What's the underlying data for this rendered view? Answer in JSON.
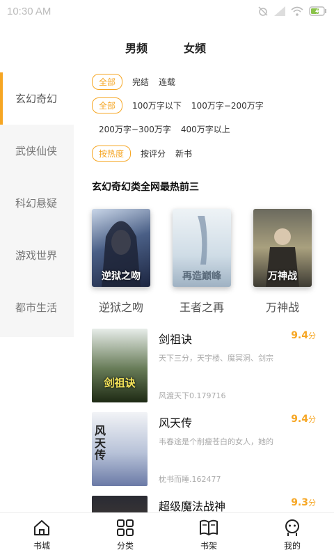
{
  "status": {
    "time": "10:30 AM",
    "icons": [
      "alarm-off-icon",
      "signal-icon",
      "wifi-icon",
      "battery-charging-icon"
    ]
  },
  "gender_tabs": [
    {
      "label": "男频",
      "active": true
    },
    {
      "label": "女频",
      "active": false
    }
  ],
  "sidebar": {
    "items": [
      {
        "label": "玄幻奇幻",
        "active": true
      },
      {
        "label": "武侠仙侠"
      },
      {
        "label": "科幻悬疑"
      },
      {
        "label": "游戏世界"
      },
      {
        "label": "都市生活"
      }
    ]
  },
  "filters": {
    "status": [
      "全部",
      "完结",
      "连载"
    ],
    "words": [
      "全部",
      "100万字以下",
      "100万字−200万字",
      "200万字−300万字",
      "400万字以上"
    ],
    "sort": [
      "按热度",
      "按评分",
      "新书"
    ]
  },
  "section_title": "玄幻奇幻类全网最热前三",
  "top3": [
    {
      "name": "逆狱之吻",
      "cover_text": "逆狱之吻"
    },
    {
      "name": "王者之再",
      "cover_text": "再造巅峰"
    },
    {
      "name": "万神战",
      "cover_text": "万神战"
    }
  ],
  "books": [
    {
      "title": "剑祖诀",
      "score": "9.4",
      "unit": "分",
      "desc": "天下三分，天宇楼、魔冥洞、剑宗",
      "author": "风渡天下0.179716",
      "cover_text": "剑祖诀"
    },
    {
      "title": "风天传",
      "score": "9.4",
      "unit": "分",
      "desc": "韦春途是个削瘦苍白的女人，她的",
      "author": "枕书而睡.162477",
      "cover_text": "风天传"
    },
    {
      "title": "超级魔法战神",
      "score": "9.3",
      "unit": "分",
      "desc": "",
      "author": "",
      "cover_text": ""
    }
  ],
  "bottom_nav": [
    {
      "label": "书城",
      "icon": "home-icon"
    },
    {
      "label": "分类",
      "icon": "category-grid-icon"
    },
    {
      "label": "书架",
      "icon": "bookshelf-icon"
    },
    {
      "label": "我的",
      "icon": "profile-icon"
    }
  ],
  "colors": {
    "accent": "#f6a623",
    "sidebar_bg": "#f6f6f6",
    "muted_text": "#aaaaaa"
  }
}
